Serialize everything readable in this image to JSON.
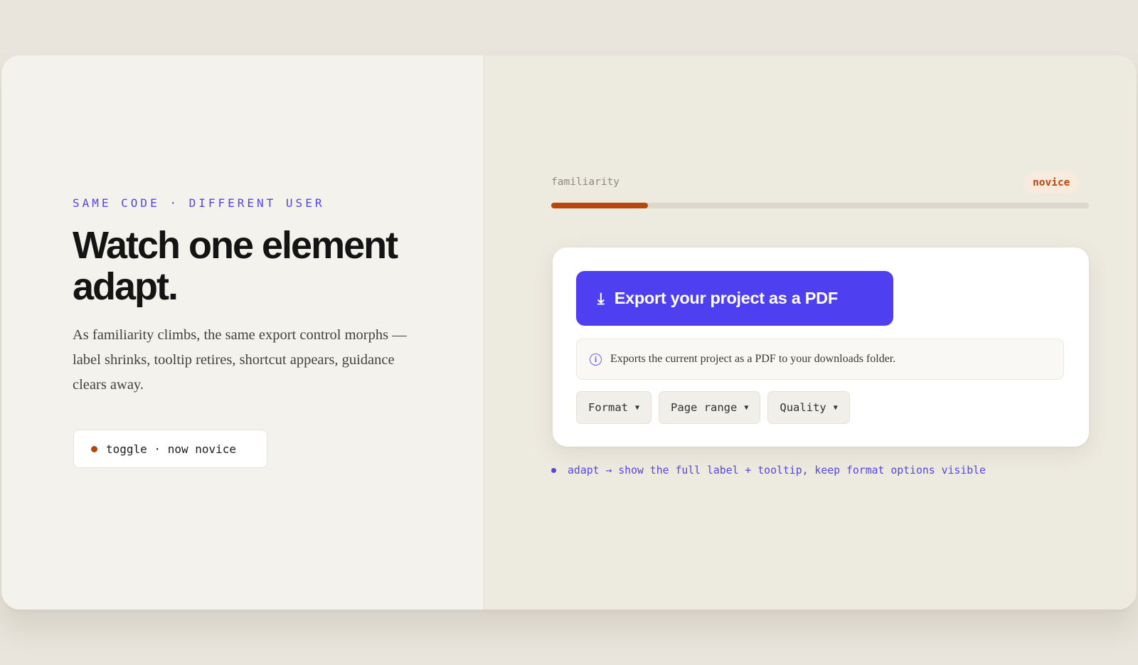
{
  "intro": {
    "eyebrow": "SAME CODE · DIFFERENT USER",
    "headline": "Watch one element adapt.",
    "body": "As familiarity climbs, the same export control morphs — label shrinks, tooltip retires, shortcut appears, guidance clears away.",
    "toggle_label": "toggle · now novice"
  },
  "familiarity": {
    "label": "familiarity",
    "level": "novice",
    "progress": 0.18
  },
  "export_control": {
    "icon": "download-arrow-icon",
    "icon_glyph": "⤓",
    "button_label": "Export your project as a PDF",
    "tooltip": "Exports the current project as a PDF to your downloads folder.",
    "options": [
      {
        "label": "Format"
      },
      {
        "label": "Page range"
      },
      {
        "label": "Quality"
      }
    ]
  },
  "adapt_note": "adapt → show the full label + tooltip, keep format options visible",
  "colors": {
    "accent": "#4e3ff0",
    "warm": "#b4480f",
    "background": "#e9e5dc"
  }
}
